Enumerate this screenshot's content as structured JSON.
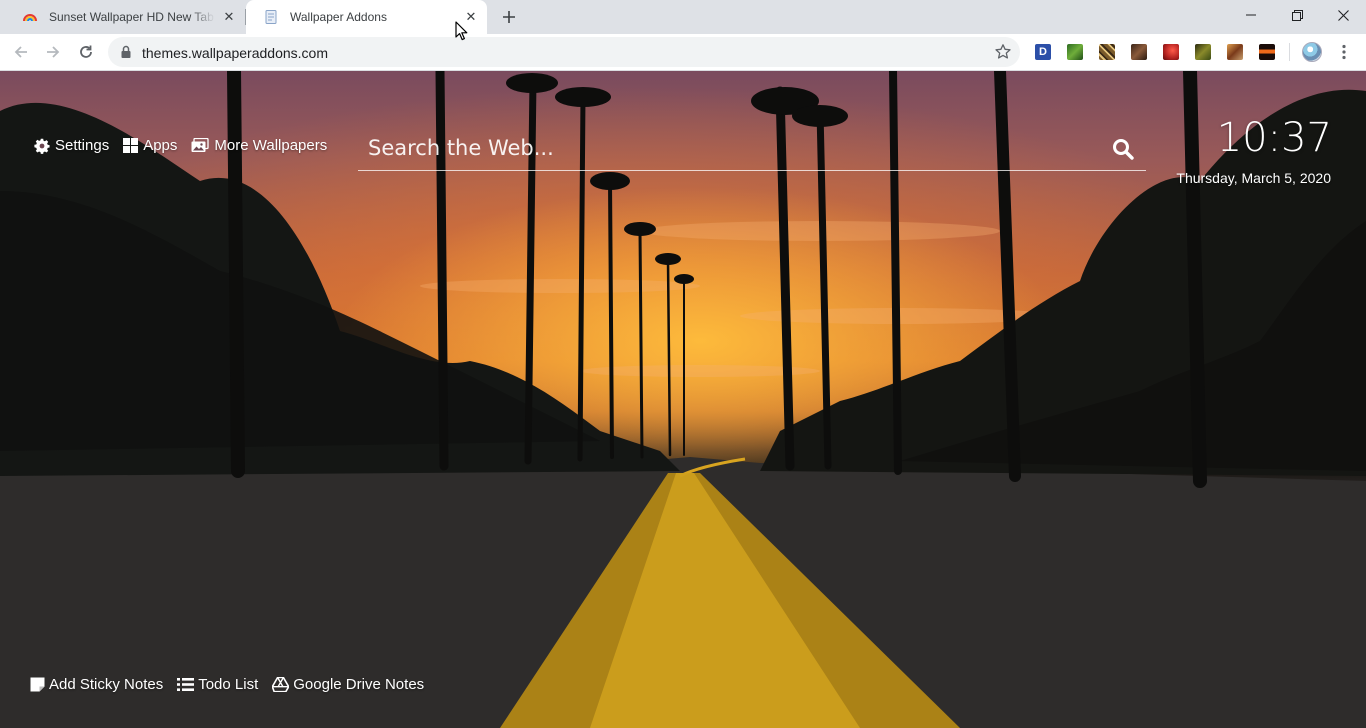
{
  "browser": {
    "tabs": [
      {
        "title": "Sunset Wallpaper HD New Tab Theme",
        "favicon": "rainbow-favicon-icon",
        "active": false
      },
      {
        "title": "Wallpaper Addons",
        "favicon": "page-favicon-icon",
        "active": true
      }
    ],
    "address": "themes.wallpaperaddons.com",
    "extensions": [
      {
        "name": "d-extension-icon",
        "label": "D",
        "color": "#2b4fa8"
      },
      {
        "name": "green-extension-icon",
        "color": "#3a7d2c"
      },
      {
        "name": "pattern-extension-icon",
        "color": "#7a5a2a"
      },
      {
        "name": "brown-extension-icon",
        "color": "#5a3a24"
      },
      {
        "name": "red-extension-icon",
        "color": "#b0201f"
      },
      {
        "name": "olive-extension-icon",
        "color": "#6a6a20"
      },
      {
        "name": "orange-extension-icon",
        "color": "#b8662a"
      },
      {
        "name": "sunset-extension-icon",
        "color": "#d0541a"
      }
    ]
  },
  "page": {
    "nav": {
      "settings": "Settings",
      "apps": "Apps",
      "more_wallpapers": "More Wallpapers"
    },
    "search": {
      "placeholder": "Search the Web..."
    },
    "clock": {
      "time": "10:37",
      "date": "Thursday, March 5, 2020"
    },
    "bottom": {
      "sticky_notes": "Add Sticky Notes",
      "todo": "Todo List",
      "drive_notes": "Google Drive Notes"
    }
  }
}
